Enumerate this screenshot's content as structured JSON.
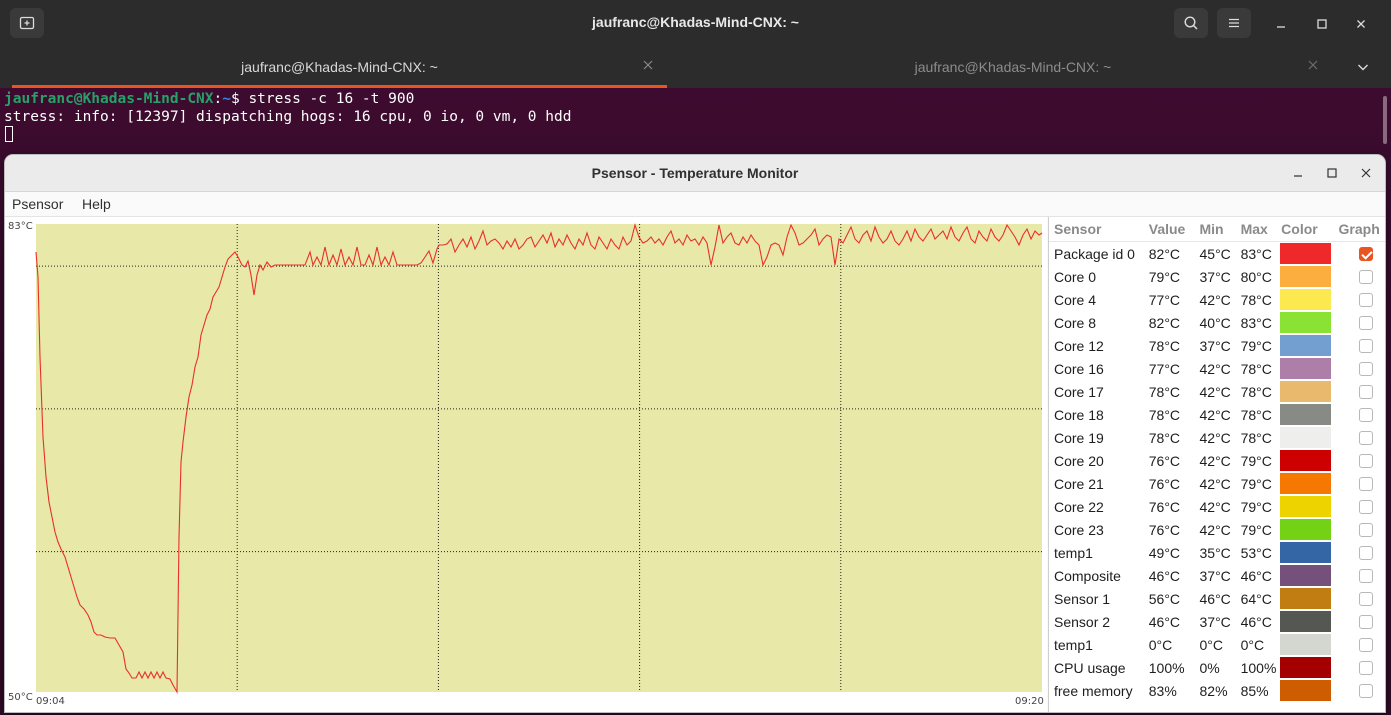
{
  "terminal": {
    "title": "jaufranc@Khadas-Mind-CNX: ~",
    "tabs": [
      {
        "label": "jaufranc@Khadas-Mind-CNX: ~",
        "active": true
      },
      {
        "label": "jaufranc@Khadas-Mind-CNX: ~",
        "active": false
      }
    ],
    "prompt_user": "jaufranc@Khadas-Mind-CNX",
    "prompt_sep": ":",
    "prompt_path": "~",
    "prompt_symbol": "$",
    "command": " stress -c 16 -t 900",
    "output": "stress: info: [12397] dispatching hogs: 16 cpu, 0 io, 0 vm, 0 hdd",
    "icons": {
      "new_tab": "new-tab-icon",
      "search": "search-icon",
      "menu": "hamburger-menu-icon",
      "minimize": "minimize-icon",
      "maximize": "maximize-icon",
      "close": "close-icon",
      "tab_close": "close-icon",
      "tab_overflow": "chevron-down-icon"
    }
  },
  "psensor": {
    "title": "Psensor - Temperature Monitor",
    "menu": [
      "Psensor",
      "Help"
    ],
    "graph": {
      "y_max_label": "83°C",
      "y_min_label": "50°C",
      "x_start_label": "09:04",
      "x_end_label": "09:20",
      "background": "#e8e8a8",
      "line_color": "#e8302a"
    },
    "table": {
      "headers": [
        "Sensor",
        "Value",
        "Min",
        "Max",
        "Color",
        "Graph"
      ],
      "rows": [
        {
          "name": "Package id 0",
          "value": "82°C",
          "min": "45°C",
          "max": "83°C",
          "color": "#ef2929",
          "graph": true
        },
        {
          "name": "Core 0",
          "value": "79°C",
          "min": "37°C",
          "max": "80°C",
          "color": "#fcaf3e",
          "graph": false
        },
        {
          "name": "Core 4",
          "value": "77°C",
          "min": "42°C",
          "max": "78°C",
          "color": "#fce94f",
          "graph": false
        },
        {
          "name": "Core 8",
          "value": "82°C",
          "min": "40°C",
          "max": "83°C",
          "color": "#8ae234",
          "graph": false
        },
        {
          "name": "Core 12",
          "value": "78°C",
          "min": "37°C",
          "max": "79°C",
          "color": "#729fcf",
          "graph": false
        },
        {
          "name": "Core 16",
          "value": "77°C",
          "min": "42°C",
          "max": "78°C",
          "color": "#ad7fa8",
          "graph": false
        },
        {
          "name": "Core 17",
          "value": "78°C",
          "min": "42°C",
          "max": "78°C",
          "color": "#e9b96e",
          "graph": false
        },
        {
          "name": "Core 18",
          "value": "78°C",
          "min": "42°C",
          "max": "78°C",
          "color": "#888a85",
          "graph": false
        },
        {
          "name": "Core 19",
          "value": "78°C",
          "min": "42°C",
          "max": "78°C",
          "color": "#eeeeec",
          "graph": false
        },
        {
          "name": "Core 20",
          "value": "76°C",
          "min": "42°C",
          "max": "79°C",
          "color": "#cc0000",
          "graph": false
        },
        {
          "name": "Core 21",
          "value": "76°C",
          "min": "42°C",
          "max": "79°C",
          "color": "#f57900",
          "graph": false
        },
        {
          "name": "Core 22",
          "value": "76°C",
          "min": "42°C",
          "max": "79°C",
          "color": "#edd400",
          "graph": false
        },
        {
          "name": "Core 23",
          "value": "76°C",
          "min": "42°C",
          "max": "79°C",
          "color": "#73d216",
          "graph": false
        },
        {
          "name": "temp1",
          "value": "49°C",
          "min": "35°C",
          "max": "53°C",
          "color": "#3465a4",
          "graph": false
        },
        {
          "name": "Composite",
          "value": "46°C",
          "min": "37°C",
          "max": "46°C",
          "color": "#75507b",
          "graph": false
        },
        {
          "name": "Sensor 1",
          "value": "56°C",
          "min": "46°C",
          "max": "64°C",
          "color": "#c17d11",
          "graph": false
        },
        {
          "name": "Sensor 2",
          "value": "46°C",
          "min": "37°C",
          "max": "46°C",
          "color": "#555753",
          "graph": false
        },
        {
          "name": "temp1",
          "value": "0°C",
          "min": "0°C",
          "max": "0°C",
          "color": "#d3d7cf",
          "graph": false
        },
        {
          "name": "CPU usage",
          "value": "100%",
          "min": "0%",
          "max": "100%",
          "color": "#a40000",
          "graph": false
        },
        {
          "name": "free memory",
          "value": "83%",
          "min": "82%",
          "max": "85%",
          "color": "#ce5c00",
          "graph": false
        }
      ]
    },
    "icons": {
      "minimize": "minimize-icon",
      "maximize": "maximize-icon",
      "close": "close-icon",
      "graph_checkbox": "checkbox-icon"
    }
  }
}
